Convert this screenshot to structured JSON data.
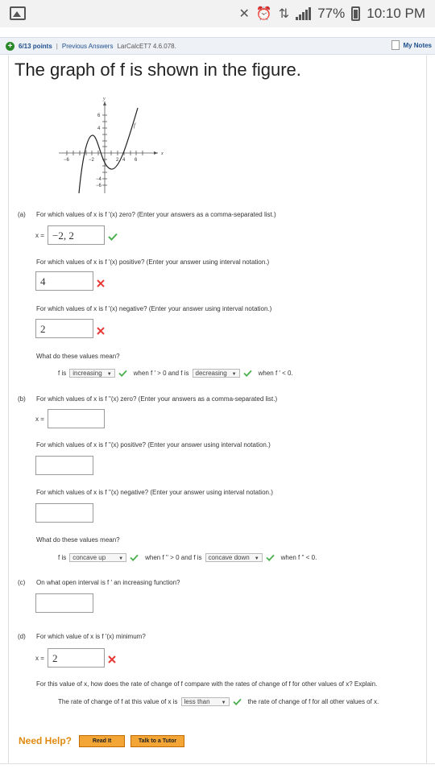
{
  "status": {
    "battery": "77%",
    "time": "10:10 PM"
  },
  "header": {
    "points": "6/13 points",
    "previous_answers": "Previous Answers",
    "reference": "LarCalcET7 4.6.078.",
    "my_notes": "My Notes"
  },
  "title": "The graph of f is shown in the figure.",
  "graph": {
    "axis_x": "x",
    "axis_y": "y",
    "curve_label": "f",
    "x_ticks": [
      "−6",
      "−2",
      "2",
      "4",
      "6"
    ],
    "y_ticks": [
      "6",
      "4",
      "−4",
      "−6"
    ]
  },
  "a": {
    "part": "(a)",
    "q1": "For which values of x is f '(x) zero? (Enter your answers as a comma-separated list.)",
    "x_label": "x =",
    "a1": "−2, 2",
    "q2": "For which values of x is f '(x) positive? (Enter your answer using interval notation.)",
    "a2": "4",
    "q3": "For which values of x is f '(x) negative? (Enter your answer using interval notation.)",
    "a3": "2",
    "q4": "What do these values mean?",
    "s_f_is": "f is",
    "sel1": "increasing",
    "s_when1": "when f ′ > 0 and f is",
    "sel2": "decreasing",
    "s_when2": "when f ′ < 0."
  },
  "b": {
    "part": "(b)",
    "q1": "For which values of x is f ''(x) zero? (Enter your answers as a comma-separated list.)",
    "x_label": "x =",
    "a1": "",
    "q2": "For which values of x is f ''(x) positive? (Enter your answer using interval notation.)",
    "a2": "",
    "q3": "For which values of x is f ''(x) negative? (Enter your answer using interval notation.)",
    "a3": "",
    "q4": "What do these values mean?",
    "s_f_is": "f is",
    "sel1": "concave up",
    "s_when1": "when f '' > 0 and f is",
    "sel2": "concave down",
    "s_when2": "when f '' < 0."
  },
  "c": {
    "part": "(c)",
    "q1": "On what open interval is f ′ an increasing function?",
    "a1": ""
  },
  "d": {
    "part": "(d)",
    "q1": "For which value of x is f '(x) minimum?",
    "x_label": "x =",
    "a1": "2",
    "q2": "For this value of x, how does the rate of change of f compare with the rates of change of f for other values of x? Explain.",
    "s1": "The rate of change of f at this value of x is",
    "sel": "less than",
    "s2": "the rate of change of f for all other values of x."
  },
  "help": {
    "label": "Need Help?",
    "read_it": "Read It",
    "talk": "Talk to a Tutor"
  },
  "colors": {
    "check": "#4caf50",
    "x": "#e53935",
    "link": "#1f4e8c",
    "help": "#e08a10"
  }
}
